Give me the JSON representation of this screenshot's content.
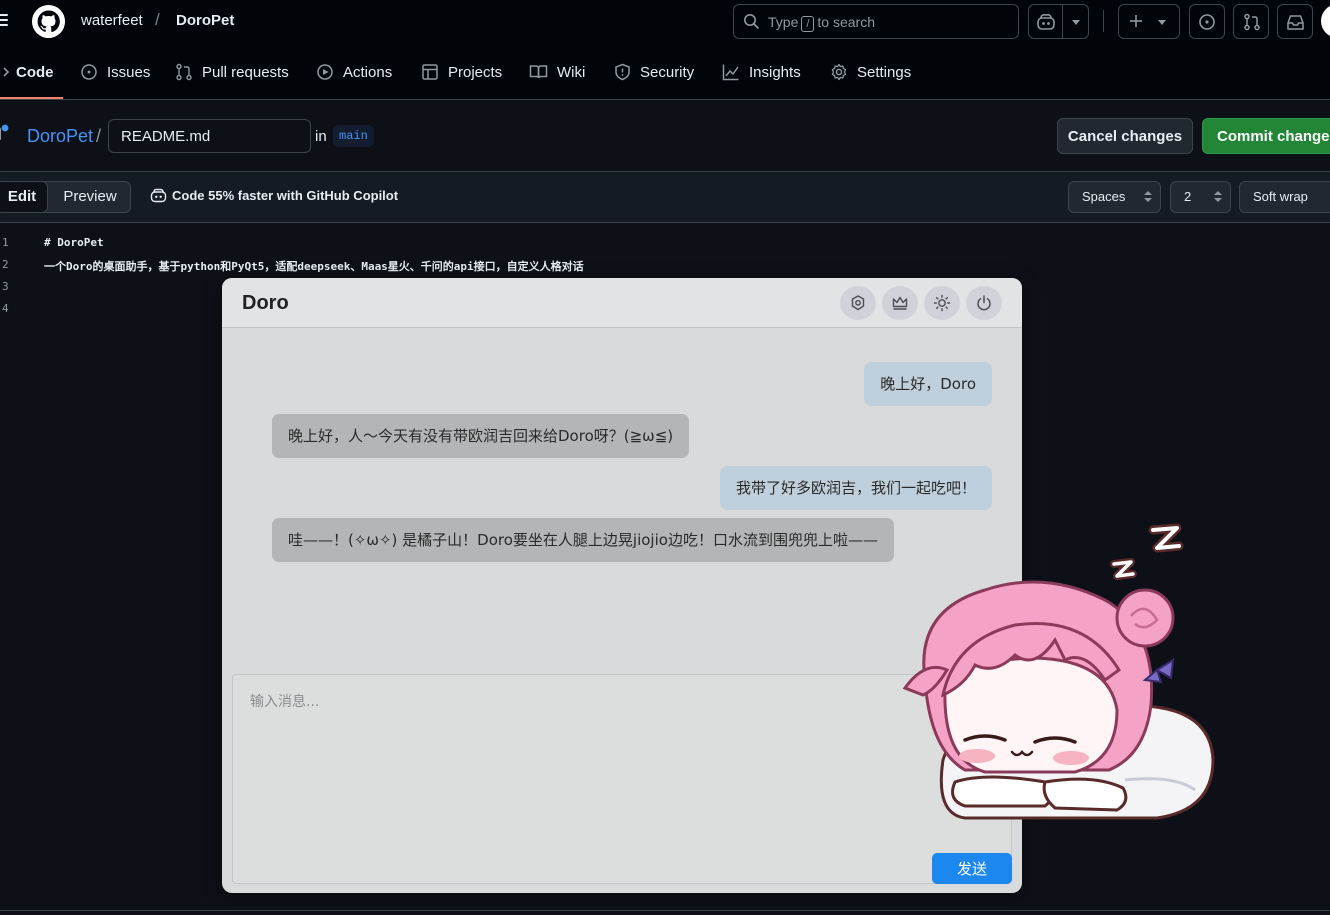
{
  "header": {
    "owner": "waterfeet",
    "separator": "/",
    "repo": "DoroPet",
    "search_prefix": "Type",
    "search_key": "/",
    "search_suffix": "to search"
  },
  "repo_nav": {
    "tabs": [
      {
        "label": "Code",
        "icon": "code-icon"
      },
      {
        "label": "Issues",
        "icon": "issue-opened-icon"
      },
      {
        "label": "Pull requests",
        "icon": "pull-request-icon"
      },
      {
        "label": "Actions",
        "icon": "play-icon"
      },
      {
        "label": "Projects",
        "icon": "table-icon"
      },
      {
        "label": "Wiki",
        "icon": "book-icon"
      },
      {
        "label": "Security",
        "icon": "shield-icon"
      },
      {
        "label": "Insights",
        "icon": "graph-icon"
      },
      {
        "label": "Settings",
        "icon": "gear-icon"
      }
    ],
    "selected": "Code"
  },
  "editor": {
    "repo_link": "DoroPet",
    "slash": "/",
    "filename": "README.md",
    "in_label": "in",
    "branch": "main",
    "cancel_label": "Cancel changes",
    "commit_label": "Commit changes",
    "edit_tab": "Edit",
    "preview_tab": "Preview",
    "copilot_tip": "Code 55% faster with GitHub Copilot",
    "indent_mode": "Spaces",
    "indent_size": "2",
    "wrap_mode": "Soft wrap",
    "lines": [
      {
        "num": "1",
        "text": "# DoroPet"
      },
      {
        "num": "2",
        "text": "一个Doro的桌面助手，基于python和PyQt5，适配deepseek、Maas星火、千问的api接口，自定义人格对话"
      },
      {
        "num": "3",
        "text": ""
      },
      {
        "num": "4",
        "text": ""
      }
    ]
  },
  "chat": {
    "title": "Doro",
    "header_buttons": [
      "settings-icon",
      "crown-icon",
      "theme-sun-icon",
      "power-icon"
    ],
    "messages": [
      {
        "role": "user",
        "text": "晚上好，Doro"
      },
      {
        "role": "bot",
        "text": "晚上好，人～今天有没有带欧润吉回来给Doro呀？(≧ω≦)"
      },
      {
        "role": "user",
        "text": "我带了好多欧润吉，我们一起吃吧！"
      },
      {
        "role": "bot",
        "text": "哇——！(✧ω✧) 是橘子山！Doro要坐在人腿上边晃jiojio边吃！口水流到围兜兜上啦——"
      }
    ],
    "input_placeholder": "输入消息...",
    "send_label": "发送"
  },
  "colors": {
    "accent_blue": "#4493f8",
    "commit_green": "#238636",
    "tab_underline": "#f78166",
    "send_blue": "#1d87f0"
  }
}
